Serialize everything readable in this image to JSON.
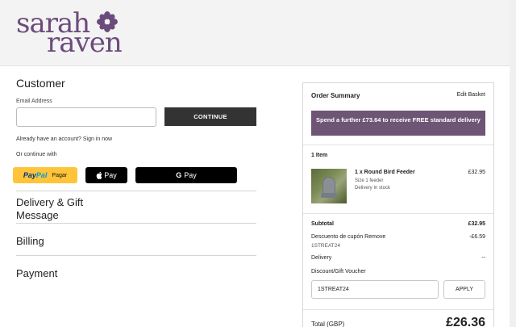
{
  "brand": {
    "line1": "sarah",
    "line2": "raven",
    "color": "#6b4b7c"
  },
  "customer": {
    "title": "Customer",
    "email_label": "Email Address",
    "email_value": "",
    "continue_label": "CONTINUE",
    "signin_text": "Already have an account? Sign in now",
    "or_continue": "Or continue with",
    "paypal_pay": "Pay",
    "paypal_pal": "Pal",
    "paypal_pagar": "Pagar",
    "applepay_label": "Pay",
    "gpay_g": "G",
    "gpay_label": "Pay"
  },
  "sections": {
    "delivery_line1": "Delivery & Gift",
    "delivery_line2": "Message",
    "billing": "Billing",
    "payment": "Payment"
  },
  "order_summary": {
    "title": "Order Summary",
    "edit_basket": "Edit Basket",
    "promo_banner": "Spend a further £73.64 to receive FREE standard delivery",
    "promo_color": "#6e5475",
    "items_count": "1 Item",
    "item": {
      "name": "1 x Round Bird Feeder",
      "size": "Size 1 feeder",
      "delivery": "Delivery In stock",
      "price": "£32.95"
    },
    "subtotal_label": "Subtotal",
    "subtotal_value": "£32.95",
    "discount_label": "Descuento de cupón",
    "remove_label": "Remove",
    "discount_code": "1STREAT24",
    "discount_value": "-£6.59",
    "delivery_label": "Delivery",
    "delivery_value": "--",
    "voucher_label": "Discount/Gift Voucher",
    "voucher_value": "1STREAT24",
    "apply_label": "APPLY",
    "total_label": "Total (GBP)",
    "total_value": "£26.36"
  }
}
